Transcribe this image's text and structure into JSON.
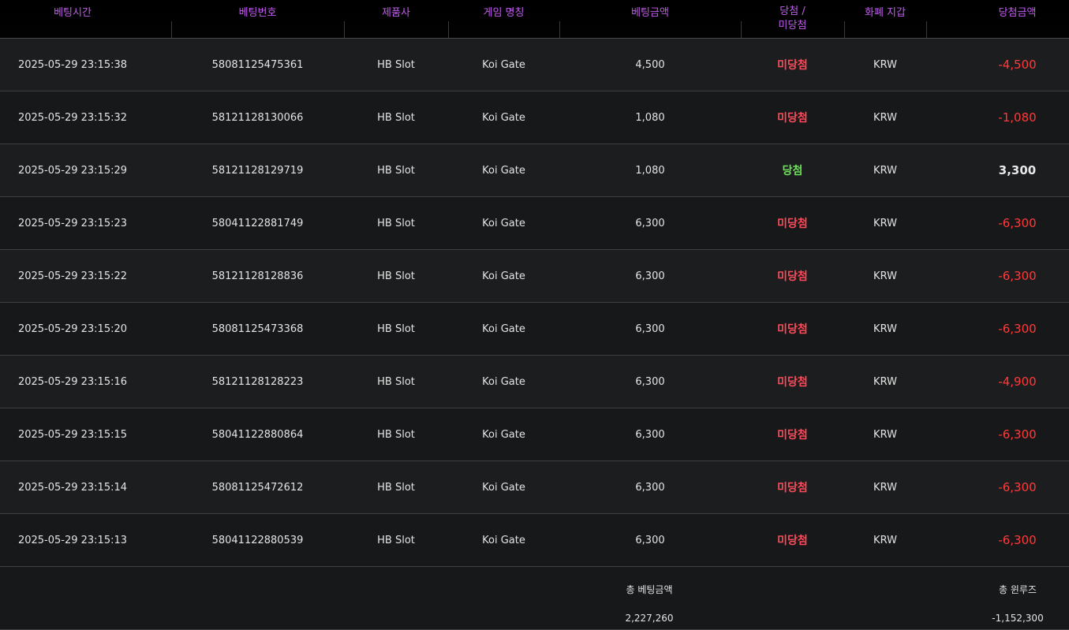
{
  "header": {
    "columns": [
      "베팅시간",
      "베팅번호",
      "제품사",
      "게임 명칭",
      "베팅금액",
      "당첨 /\n미당첨",
      "화폐 지갑",
      "당첨금액"
    ],
    "status_line1": "당첨 /",
    "status_line2": "미당첨"
  },
  "rows": [
    {
      "time": "2025-05-29 23:15:38",
      "bet_no": "58081125475361",
      "provider": "HB Slot",
      "game": "Koi Gate",
      "bet_amount": "4,500",
      "status": "미당첨",
      "currency": "KRW",
      "win_amount": "-4,500"
    },
    {
      "time": "2025-05-29 23:15:32",
      "bet_no": "58121128130066",
      "provider": "HB Slot",
      "game": "Koi Gate",
      "bet_amount": "1,080",
      "status": "미당첨",
      "currency": "KRW",
      "win_amount": "-1,080"
    },
    {
      "time": "2025-05-29 23:15:29",
      "bet_no": "58121128129719",
      "provider": "HB Slot",
      "game": "Koi Gate",
      "bet_amount": "1,080",
      "status": "당첨",
      "currency": "KRW",
      "win_amount": "3,300"
    },
    {
      "time": "2025-05-29 23:15:23",
      "bet_no": "58041122881749",
      "provider": "HB Slot",
      "game": "Koi Gate",
      "bet_amount": "6,300",
      "status": "미당첨",
      "currency": "KRW",
      "win_amount": "-6,300"
    },
    {
      "time": "2025-05-29 23:15:22",
      "bet_no": "58121128128836",
      "provider": "HB Slot",
      "game": "Koi Gate",
      "bet_amount": "6,300",
      "status": "미당첨",
      "currency": "KRW",
      "win_amount": "-6,300"
    },
    {
      "time": "2025-05-29 23:15:20",
      "bet_no": "58081125473368",
      "provider": "HB Slot",
      "game": "Koi Gate",
      "bet_amount": "6,300",
      "status": "미당첨",
      "currency": "KRW",
      "win_amount": "-6,300"
    },
    {
      "time": "2025-05-29 23:15:16",
      "bet_no": "58121128128223",
      "provider": "HB Slot",
      "game": "Koi Gate",
      "bet_amount": "6,300",
      "status": "미당첨",
      "currency": "KRW",
      "win_amount": "-4,900"
    },
    {
      "time": "2025-05-29 23:15:15",
      "bet_no": "58041122880864",
      "provider": "HB Slot",
      "game": "Koi Gate",
      "bet_amount": "6,300",
      "status": "미당첨",
      "currency": "KRW",
      "win_amount": "-6,300"
    },
    {
      "time": "2025-05-29 23:15:14",
      "bet_no": "58081125472612",
      "provider": "HB Slot",
      "game": "Koi Gate",
      "bet_amount": "6,300",
      "status": "미당첨",
      "currency": "KRW",
      "win_amount": "-6,300"
    },
    {
      "time": "2025-05-29 23:15:13",
      "bet_no": "58041122880539",
      "provider": "HB Slot",
      "game": "Koi Gate",
      "bet_amount": "6,300",
      "status": "미당첨",
      "currency": "KRW",
      "win_amount": "-6,300"
    }
  ],
  "footer": {
    "total_bet_label": "총 베팅금액",
    "total_bet_value": "2,227,260",
    "total_winloss_label": "총 윈루즈",
    "total_winloss_value": "-1,152,300"
  },
  "colors": {
    "header_text": "#c25cf0",
    "lose": "#ff4a5a",
    "win": "#6ee05a",
    "negative_amount": "#ff3a3a"
  }
}
